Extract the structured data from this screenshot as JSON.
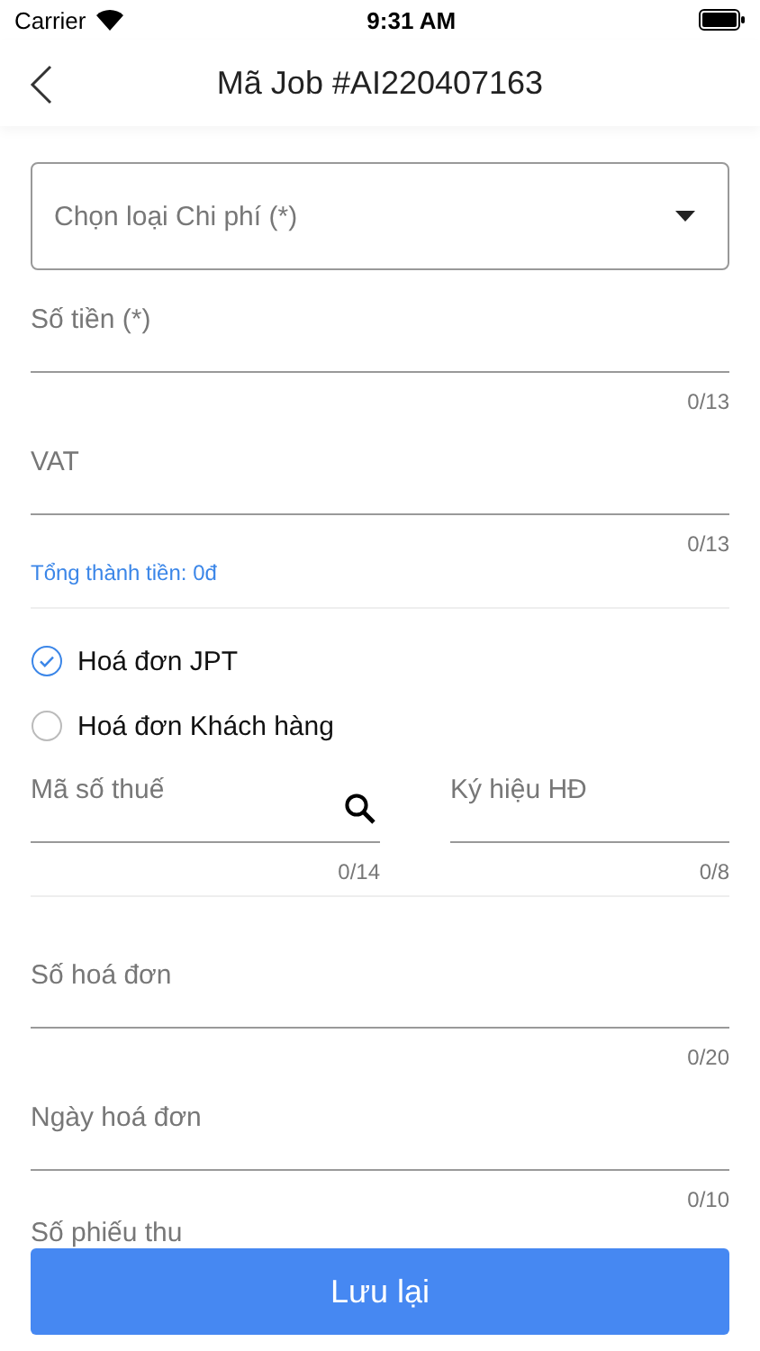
{
  "status_bar": {
    "carrier": "Carrier",
    "time": "9:31 AM"
  },
  "header": {
    "title": "Mã Job #AI220407163"
  },
  "expense_type": {
    "placeholder": "Chọn loại Chi phí (*)"
  },
  "amount_fields": [
    {
      "placeholder": "Số tiền (*)",
      "counter": "0/13"
    },
    {
      "placeholder": "VAT",
      "counter": "0/13"
    }
  ],
  "total": "Tổng thành tiền: 0đ",
  "invoice_types": [
    {
      "label": "Hoá đơn JPT",
      "selected": true
    },
    {
      "label": "Hoá đơn Khách hàng",
      "selected": false
    }
  ],
  "tax_fields": [
    {
      "kind": "search",
      "placeholder": "Mã số thuế",
      "counter": "0/14"
    },
    {
      "kind": "text",
      "placeholder": "Ký hiệu HĐ",
      "counter": "0/8"
    }
  ],
  "invoice_fields": [
    {
      "placeholder": "Số hoá đơn",
      "counter": "0/20"
    },
    {
      "placeholder": "Ngày hoá đơn",
      "counter": "0/10"
    }
  ],
  "receipt_field": {
    "placeholder": "Số phiếu thu"
  },
  "save_button": "Lưu lại"
}
